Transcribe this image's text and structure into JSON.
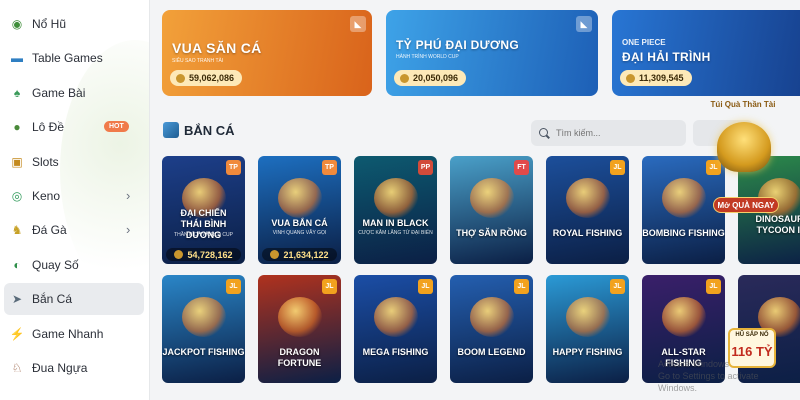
{
  "sidebar": {
    "items": [
      {
        "label": "Nổ Hũ",
        "icon": "slot-jar-icon"
      },
      {
        "label": "Table Games",
        "icon": "table-icon"
      },
      {
        "label": "Game Bài",
        "icon": "cards-icon"
      },
      {
        "label": "Lô Đề",
        "icon": "lottery-ball-icon",
        "badge": "HOT"
      },
      {
        "label": "Slots",
        "icon": "slot-machine-icon"
      },
      {
        "label": "Keno",
        "icon": "keno-icon",
        "chevron": true
      },
      {
        "label": "Đá Gà",
        "icon": "rooster-icon",
        "chevron": true
      },
      {
        "label": "Quay Số",
        "icon": "spin-icon"
      },
      {
        "label": "Bắn Cá",
        "icon": "fish-icon",
        "active": true
      },
      {
        "label": "Game Nhanh",
        "icon": "lightning-icon"
      },
      {
        "label": "Đua Ngựa",
        "icon": "horse-icon"
      }
    ]
  },
  "banners": [
    {
      "title": "VUA SĂN CÁ",
      "subtitle": "SIÊU SAO TRANH TÀI",
      "amount": "59,062,086",
      "color": "#e98a1f"
    },
    {
      "title": "TỶ PHÚ ĐẠI DƯƠNG",
      "subtitle": "HÀNH TRÌNH WORLD CUP",
      "amount": "20,050,096",
      "color": "#2d8ad8"
    },
    {
      "title": "ĐẠI HẢI TRÌNH",
      "logo": "ONE PIECE",
      "amount": "11,309,545",
      "color": "#1b5fb8"
    }
  ],
  "section": {
    "title": "BẮN CÁ",
    "search_placeholder": "Tìm kiếm..."
  },
  "games_row1": [
    {
      "title_line1": "ĐẠI CHIẾN",
      "title_line2": "THÁI BÌNH DƯƠNG",
      "subtitle": "THẦN KÌCH WORLD CUP",
      "jackpot": "54,728,162",
      "provider": "TP",
      "color": "#1d3f8a"
    },
    {
      "title_line1": "VUA BẮN CÁ",
      "subtitle": "VINH QUANG VẪY GỌI",
      "jackpot": "21,634,122",
      "provider": "TP",
      "color": "#1d6fc0"
    },
    {
      "title_line1": "MAN IN BLACK",
      "subtitle": "CƯỢC KÂM LĂNG TỪ ĐẠI BIỂN",
      "provider": "PP",
      "color": "#0d5a70"
    },
    {
      "title_line1": "THỢ SĂN RỒNG",
      "provider": "FT",
      "color": "#4aa0c9"
    },
    {
      "title_line1": "ROYAL FISHING",
      "provider": "JL",
      "color": "#1c4f9b"
    },
    {
      "title_line1": "BOMBING FISHING",
      "provider": "JL",
      "color": "#2a6bbf"
    },
    {
      "title_line1": "DINOSAUR",
      "title_line2": "TYCOON II",
      "provider": "JL",
      "color": "#2c8a4a"
    }
  ],
  "games_row2": [
    {
      "title_line1": "JACKPOT FISHING",
      "provider": "JL",
      "color": "#2a86c8"
    },
    {
      "title_line1": "DRAGON FORTUNE",
      "provider": "JL",
      "color": "#b0321e"
    },
    {
      "title_line1": "MEGA FISHING",
      "provider": "JL",
      "color": "#1b4ea6"
    },
    {
      "title_line1": "BOOM LEGEND",
      "provider": "JL",
      "color": "#245fb0"
    },
    {
      "title_line1": "HAPPY FISHING",
      "provider": "JL",
      "color": "#2b9ad6"
    },
    {
      "title_line1": "ALL-STAR FISHING",
      "provider": "JL",
      "color": "#3a1f6a"
    },
    {
      "title_line1": "",
      "provider": "JL",
      "color": "#2a2a5a"
    }
  ],
  "promo": {
    "title": "Túi Quà Thần Tài",
    "button": "Mở QUÀ NGAY"
  },
  "jackpot_float": {
    "label": "HŨ SẮP NỔ",
    "value": "116 TỶ"
  },
  "watermark": {
    "line1": "Activate Windows",
    "line2": "Go to Settings to activate Windows."
  }
}
